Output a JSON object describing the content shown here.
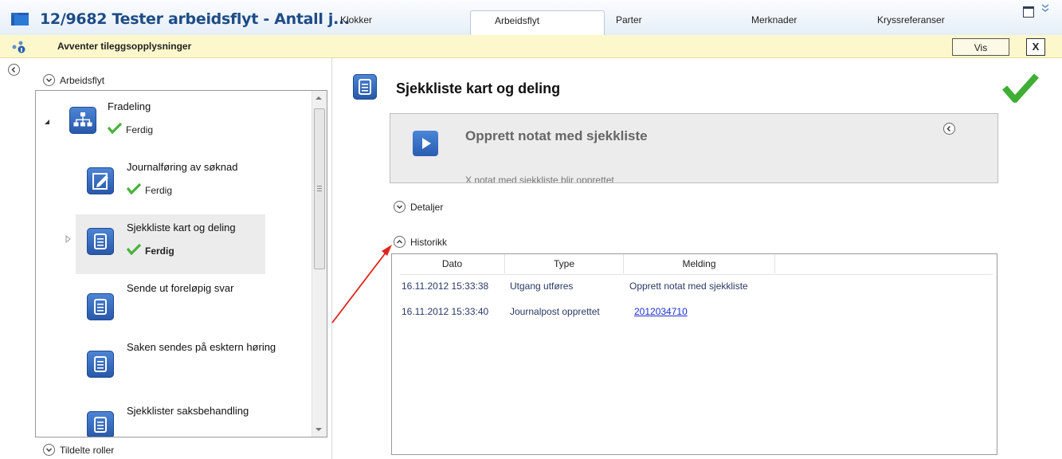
{
  "window": {
    "title": "12/9682 Tester arbeidsflyt - Antall j...",
    "tabs": [
      "Klokker",
      "Arbeidsflyt",
      "Parter",
      "Merknader",
      "Kryssreferanser"
    ],
    "active_tab": "Arbeidsflyt"
  },
  "status_bar": {
    "text": "Avventer tileggsopplysninger",
    "vis_label": "Vis",
    "close_label": "X"
  },
  "sidebar": {
    "arbeidsflyt_label": "Arbeidsflyt",
    "tildelte_label": "Tildelte roller",
    "workflow": [
      {
        "title": "Fradeling",
        "status": "Ferdig",
        "icon": "org-chart-icon"
      },
      {
        "title": "Journalføring av søknad",
        "status": "Ferdig",
        "icon": "edit-document-icon"
      },
      {
        "title": "Sjekkliste kart og deling",
        "status": "Ferdig",
        "icon": "document-icon"
      },
      {
        "title": "Sende ut foreløpig svar",
        "status": "",
        "icon": "document-icon"
      },
      {
        "title": "Saken sendes på esktern høring",
        "status": "",
        "icon": "document-icon"
      },
      {
        "title": "Sjekklister saksbehandling",
        "status": "",
        "icon": "document-icon"
      }
    ]
  },
  "main": {
    "title": "Sjekkliste kart og deling",
    "action": {
      "title": "Opprett notat med sjekkliste",
      "subtitle": "X notat med sjekkliste blir opprettet"
    },
    "detaljer_label": "Detaljer",
    "historikk_label": "Historikk",
    "history": {
      "columns": [
        "Dato",
        "Type",
        "Melding"
      ],
      "rows": [
        {
          "dato": "16.11.2012 15:33:38",
          "type": "Utgang utføres",
          "melding": "Opprett notat med sjekkliste"
        },
        {
          "dato": "16.11.2012 15:33:40",
          "type": "Journalpost opprettet",
          "melding": "2012034710"
        }
      ]
    }
  },
  "colors": {
    "accent_blue": "#2a5db0",
    "check_green": "#46b33a",
    "status_yellow": "#fdf8cc",
    "arrow_red": "#e0231d"
  }
}
